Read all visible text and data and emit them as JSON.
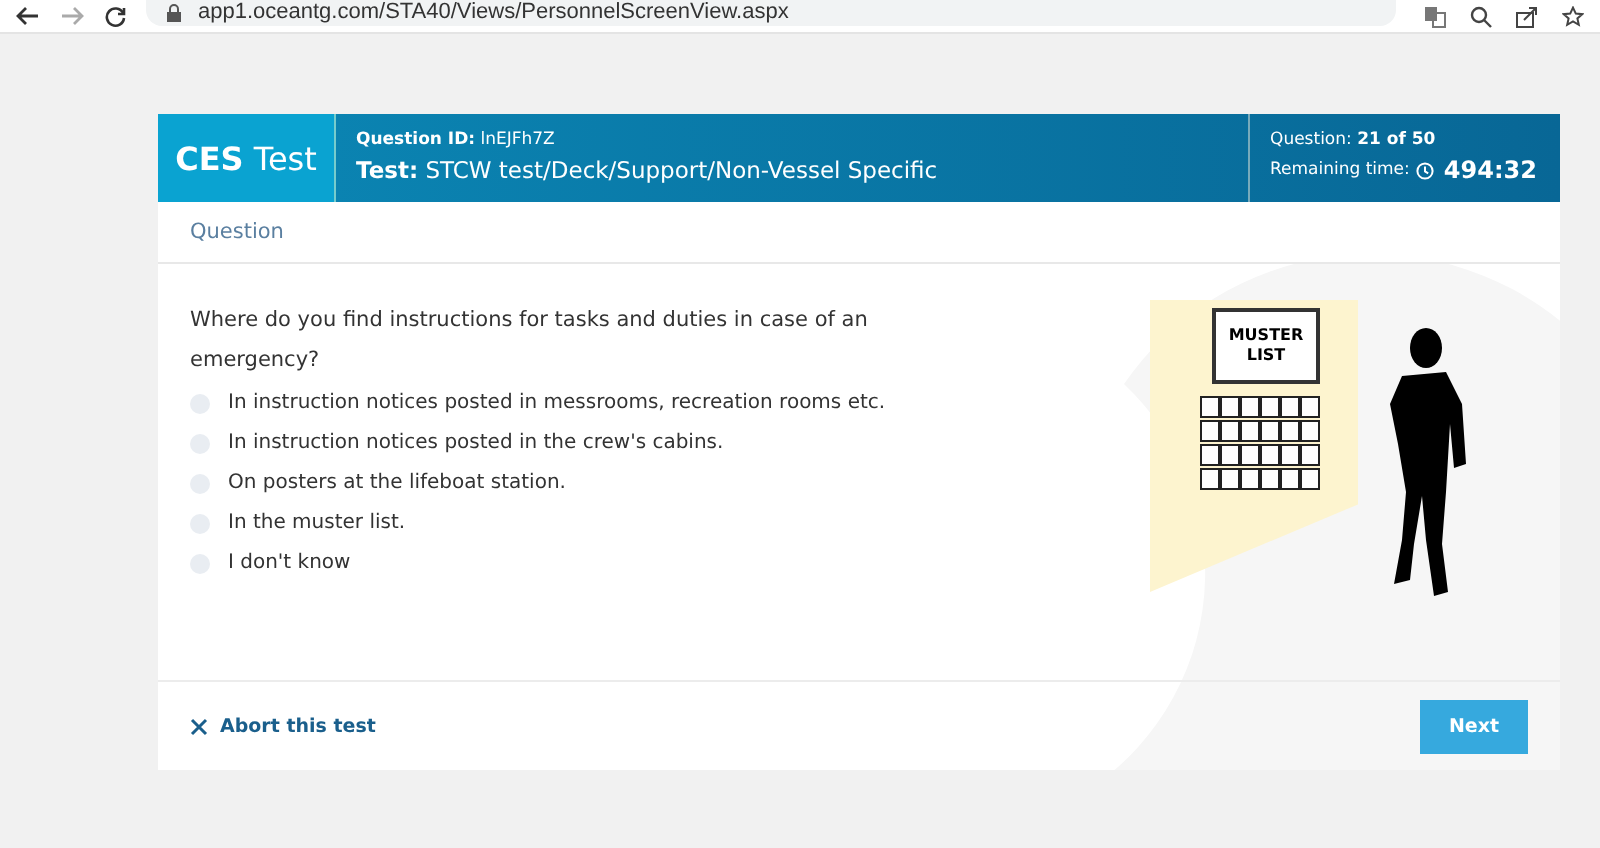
{
  "browser": {
    "url": "app1.oceantg.com/STA40/Views/PersonnelScreenView.aspx"
  },
  "header": {
    "brand": "**CES** Test",
    "question_id_label": "Question ID:",
    "question_id": "lnEJFh7Z",
    "test_label": "Test:",
    "test": "STCW test/Deck/Support/Non-Vessel Specific",
    "progress_label": "Question:",
    "progress": "21 of 50",
    "time_label": "Remaining time:",
    "time": "494:32"
  },
  "section_title": "Question",
  "question": "Where do you find instructions for tasks and duties in case of an emergency?",
  "answers": [
    {
      "label": "In instruction notices posted in messrooms, recreation rooms etc.",
      "selected": false
    },
    {
      "label": "In instruction notices posted in the crew's cabins.",
      "selected": false
    },
    {
      "label": "On posters at the lifeboat station.",
      "selected": false
    },
    {
      "label": "In the muster list.",
      "selected": false
    },
    {
      "label": "I don't know",
      "selected": false
    }
  ],
  "illustration": {
    "sign_lines": [
      "MUSTER",
      "LIST"
    ]
  },
  "footer": {
    "abort": "Abort this test",
    "next": "Next"
  }
}
